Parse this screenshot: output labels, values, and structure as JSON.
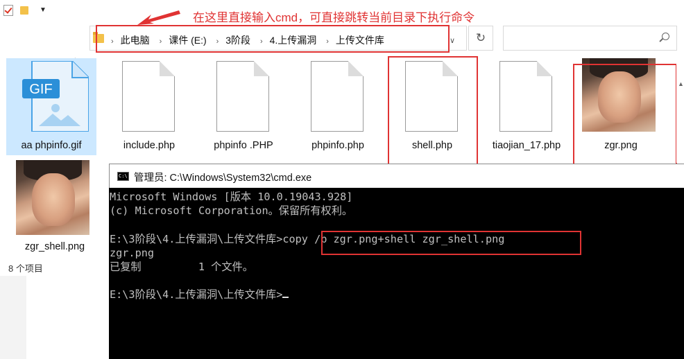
{
  "annotation": "在这里直接输入cmd，可直接跳转当前目录下执行命令",
  "address_bar": {
    "crumbs": [
      "此电脑",
      "课件 (E:)",
      "3阶段",
      "4.上传漏洞",
      "上传文件库"
    ]
  },
  "files": [
    {
      "name": "aa phpinfo.gif",
      "icon": "gif-file-icon",
      "selected": true
    },
    {
      "name": "include.php",
      "icon": "document-icon"
    },
    {
      "name": "phpinfo .PHP",
      "icon": "document-icon"
    },
    {
      "name": "phpinfo.php",
      "icon": "document-icon"
    },
    {
      "name": "shell.php",
      "icon": "document-icon"
    },
    {
      "name": "tiaojian_17.php",
      "icon": "document-icon"
    },
    {
      "name": "zgr.png",
      "icon": "image-thumbnail"
    },
    {
      "name": "zgr_shell.png",
      "icon": "image-thumbnail"
    }
  ],
  "gif_badge": "GIF",
  "status_bar": "8 个项目",
  "cmd": {
    "title": "管理员: C:\\Windows\\System32\\cmd.exe",
    "icon_text": "C:\\",
    "lines": [
      "Microsoft Windows [版本 10.0.19043.928]",
      "(c) Microsoft Corporation。保留所有权利。",
      "",
      "E:\\3阶段\\4.上传漏洞\\上传文件库>copy /b zgr.png+shell zgr_shell.png",
      "zgr.png",
      "已复制         1 个文件。",
      "",
      "E:\\3阶段\\4.上传漏洞\\上传文件库>"
    ]
  },
  "colors": {
    "annotation_red": "#e03333",
    "selection": "#cce8ff",
    "folder": "#f3c14a",
    "gif_blue": "#2b8fd8"
  }
}
